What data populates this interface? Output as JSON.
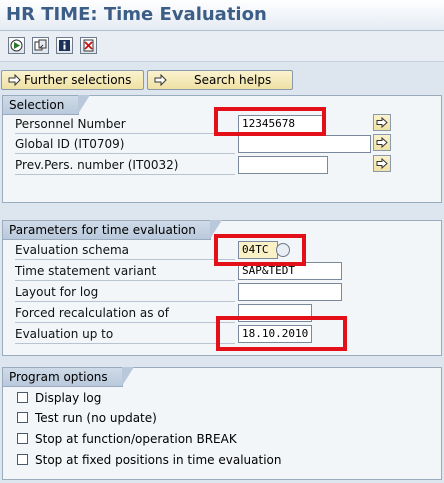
{
  "window": {
    "title": "HR TIME: Time Evaluation"
  },
  "toolbar": {
    "icons": [
      "execute-icon",
      "get-variant-icon",
      "program-info-icon",
      "delete-selection-icon"
    ]
  },
  "buttons": {
    "further_selections": "Further selections",
    "search_helps": "Search helps"
  },
  "selection": {
    "header": "Selection",
    "personnel_number": {
      "label": "Personnel Number",
      "value": "12345678"
    },
    "global_id": {
      "label": "Global ID (IT0709)",
      "value": ""
    },
    "prev_pers_number": {
      "label": "Prev.Pers. number (IT0032)",
      "value": ""
    }
  },
  "parameters": {
    "header": "Parameters for time evaluation",
    "evaluation_schema": {
      "label": "Evaluation schema",
      "value": "04TC"
    },
    "time_statement_variant": {
      "label": "Time statement variant",
      "value": "SAP&TEDT"
    },
    "layout_for_log": {
      "label": "Layout for log",
      "value": ""
    },
    "forced_recalculation": {
      "label": "Forced recalculation as of",
      "value": ""
    },
    "evaluation_up_to": {
      "label": "Evaluation up to",
      "value": "18.10.2010"
    }
  },
  "program_options": {
    "header": "Program options",
    "items": [
      {
        "label": "Display log",
        "checked": false
      },
      {
        "label": "Test run (no update)",
        "checked": false
      },
      {
        "label": "Stop at function/operation BREAK",
        "checked": false
      },
      {
        "label": "Stop at fixed positions in time evaluation",
        "checked": false
      }
    ]
  },
  "colors": {
    "highlight": "#e3101a",
    "title": "#3b5d86",
    "button_bg": "#f3e7b3"
  }
}
